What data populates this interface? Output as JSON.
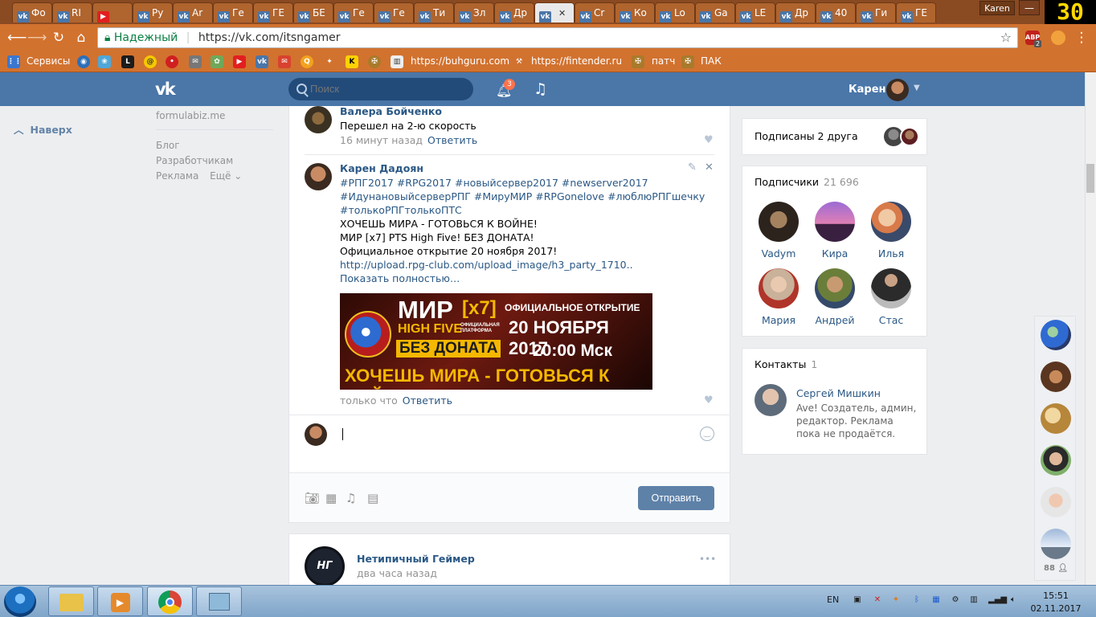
{
  "browser": {
    "tabs": [
      {
        "label": "Фо"
      },
      {
        "label": "RI"
      },
      {
        "label": ""
      },
      {
        "label": "Ру"
      },
      {
        "label": "Ar"
      },
      {
        "label": "Ге"
      },
      {
        "label": "ГЕ"
      },
      {
        "label": "БЕ"
      },
      {
        "label": "Ге"
      },
      {
        "label": "Ге"
      },
      {
        "label": "Ти"
      },
      {
        "label": "Зл"
      },
      {
        "label": "Др"
      },
      {
        "label": ""
      },
      {
        "label": "Cr"
      },
      {
        "label": "Ко"
      },
      {
        "label": "Lo"
      },
      {
        "label": "Ga"
      },
      {
        "label": "LE"
      },
      {
        "label": "Др"
      },
      {
        "label": "40"
      },
      {
        "label": "Ги"
      },
      {
        "label": "ГЕ"
      }
    ],
    "active_tab_close": "✕",
    "window_user": "Karen",
    "window_buttons": {
      "minimize": "—",
      "maximize": "❐"
    },
    "overlay_text": "30",
    "security_label": "Надежный",
    "url": "https://vk.com/itsngamer",
    "ext_badges": {
      "abp": "ABP",
      "abp_count": "2"
    }
  },
  "bookmarks": [
    {
      "label": "Сервисы"
    },
    {
      "label": "https://buhguru.com"
    },
    {
      "label": "https://fintender.ru/s"
    },
    {
      "label": "патч"
    },
    {
      "label": "ПАК"
    }
  ],
  "vk": {
    "logo": "vk",
    "search_placeholder": "Поиск",
    "notifications_count": "3",
    "user_name": "Карен"
  },
  "left": {
    "back_to_top": "Наверх",
    "site": "formulabiz.me",
    "links": [
      "Блог",
      "Разработчикам",
      "Реклама",
      "Ещё ⌄"
    ]
  },
  "comments": [
    {
      "author": "Валера Бойченко",
      "text": "Перешел на 2-ю скорость",
      "time": "16 минут назад",
      "reply": "Ответить"
    },
    {
      "author": "Карен Дадоян",
      "hashtags_line1": "#РПГ2017 #RPG2017 #новыйсервер2017 #newserver2017",
      "hashtags_line2": "#ИдунановыйсерверРПГ #МируМИР #RPGonelove #люблюРПГшечку",
      "hashtags_line3": "#толькоРПГтолькоПТС",
      "line1": "ХОЧЕШЬ МИРА - ГОТОВЬСЯ К ВОЙНЕ!",
      "line2": "МИР [x7] PTS High Five! БЕЗ ДОНАТА!",
      "line3": "Официальное открытие 20 ноября 2017!",
      "link": "http://upload.rpg-club.com/upload_image/h3_party_1710..",
      "show_more": "Показать полностью…",
      "time": "только что",
      "reply": "Ответить",
      "banner": {
        "title": "МИР",
        "rate": "[x7]",
        "subtitle": "HIGH FIVE",
        "platform": "ОФИЦИАЛЬНАЯ ПЛАТФОРМА",
        "no_donate": "БЕЗ ДОНАТА",
        "opening": "ОФИЦИАЛЬНОЕ ОТКРЫТИЕ",
        "date": "20 НОЯБРЯ 2017",
        "time": "20:00 Мск",
        "slogan": "ХОЧЕШЬ МИРА - ГОТОВЬСЯ К ВОЙНЕ"
      }
    }
  ],
  "composer": {
    "send_label": "Отправить"
  },
  "next_post": {
    "author": "Нетипичный Геймер",
    "time": "два часа назад",
    "logo": "НГ",
    "menu": "•••"
  },
  "right": {
    "friends_subscribed": "Подписаны 2 друга",
    "subscribers_title": "Подписчики",
    "subscribers_count": "21 696",
    "subscribers": [
      {
        "name": "Vadym"
      },
      {
        "name": "Кира"
      },
      {
        "name": "Илья"
      },
      {
        "name": "Мария"
      },
      {
        "name": "Андрей"
      },
      {
        "name": "Стас"
      }
    ],
    "contacts_title": "Контакты",
    "contacts_count": "1",
    "contact": {
      "name": "Сергей Мишкин",
      "desc": "Ave! Создатель, админ, редактор. Реклама пока не продаётся."
    }
  },
  "float_col": {
    "count": "88"
  },
  "taskbar": {
    "lang": "EN",
    "time": "15:51",
    "date": "02.11.2017"
  },
  "colors": {
    "vk_blue": "#4a76a8",
    "link": "#2a5885",
    "browser_theme": "#d2722f"
  }
}
